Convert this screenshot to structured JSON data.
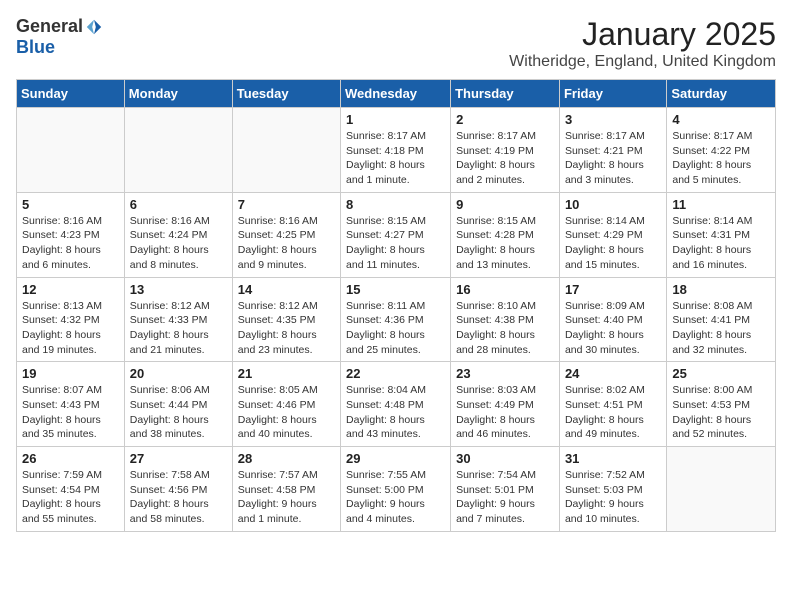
{
  "header": {
    "logo_general": "General",
    "logo_blue": "Blue",
    "month_title": "January 2025",
    "location": "Witheridge, England, United Kingdom"
  },
  "weekdays": [
    "Sunday",
    "Monday",
    "Tuesday",
    "Wednesday",
    "Thursday",
    "Friday",
    "Saturday"
  ],
  "weeks": [
    [
      {
        "day": "",
        "content": ""
      },
      {
        "day": "",
        "content": ""
      },
      {
        "day": "",
        "content": ""
      },
      {
        "day": "1",
        "content": "Sunrise: 8:17 AM\nSunset: 4:18 PM\nDaylight: 8 hours and 1 minute."
      },
      {
        "day": "2",
        "content": "Sunrise: 8:17 AM\nSunset: 4:19 PM\nDaylight: 8 hours and 2 minutes."
      },
      {
        "day": "3",
        "content": "Sunrise: 8:17 AM\nSunset: 4:21 PM\nDaylight: 8 hours and 3 minutes."
      },
      {
        "day": "4",
        "content": "Sunrise: 8:17 AM\nSunset: 4:22 PM\nDaylight: 8 hours and 5 minutes."
      }
    ],
    [
      {
        "day": "5",
        "content": "Sunrise: 8:16 AM\nSunset: 4:23 PM\nDaylight: 8 hours and 6 minutes."
      },
      {
        "day": "6",
        "content": "Sunrise: 8:16 AM\nSunset: 4:24 PM\nDaylight: 8 hours and 8 minutes."
      },
      {
        "day": "7",
        "content": "Sunrise: 8:16 AM\nSunset: 4:25 PM\nDaylight: 8 hours and 9 minutes."
      },
      {
        "day": "8",
        "content": "Sunrise: 8:15 AM\nSunset: 4:27 PM\nDaylight: 8 hours and 11 minutes."
      },
      {
        "day": "9",
        "content": "Sunrise: 8:15 AM\nSunset: 4:28 PM\nDaylight: 8 hours and 13 minutes."
      },
      {
        "day": "10",
        "content": "Sunrise: 8:14 AM\nSunset: 4:29 PM\nDaylight: 8 hours and 15 minutes."
      },
      {
        "day": "11",
        "content": "Sunrise: 8:14 AM\nSunset: 4:31 PM\nDaylight: 8 hours and 16 minutes."
      }
    ],
    [
      {
        "day": "12",
        "content": "Sunrise: 8:13 AM\nSunset: 4:32 PM\nDaylight: 8 hours and 19 minutes."
      },
      {
        "day": "13",
        "content": "Sunrise: 8:12 AM\nSunset: 4:33 PM\nDaylight: 8 hours and 21 minutes."
      },
      {
        "day": "14",
        "content": "Sunrise: 8:12 AM\nSunset: 4:35 PM\nDaylight: 8 hours and 23 minutes."
      },
      {
        "day": "15",
        "content": "Sunrise: 8:11 AM\nSunset: 4:36 PM\nDaylight: 8 hours and 25 minutes."
      },
      {
        "day": "16",
        "content": "Sunrise: 8:10 AM\nSunset: 4:38 PM\nDaylight: 8 hours and 28 minutes."
      },
      {
        "day": "17",
        "content": "Sunrise: 8:09 AM\nSunset: 4:40 PM\nDaylight: 8 hours and 30 minutes."
      },
      {
        "day": "18",
        "content": "Sunrise: 8:08 AM\nSunset: 4:41 PM\nDaylight: 8 hours and 32 minutes."
      }
    ],
    [
      {
        "day": "19",
        "content": "Sunrise: 8:07 AM\nSunset: 4:43 PM\nDaylight: 8 hours and 35 minutes."
      },
      {
        "day": "20",
        "content": "Sunrise: 8:06 AM\nSunset: 4:44 PM\nDaylight: 8 hours and 38 minutes."
      },
      {
        "day": "21",
        "content": "Sunrise: 8:05 AM\nSunset: 4:46 PM\nDaylight: 8 hours and 40 minutes."
      },
      {
        "day": "22",
        "content": "Sunrise: 8:04 AM\nSunset: 4:48 PM\nDaylight: 8 hours and 43 minutes."
      },
      {
        "day": "23",
        "content": "Sunrise: 8:03 AM\nSunset: 4:49 PM\nDaylight: 8 hours and 46 minutes."
      },
      {
        "day": "24",
        "content": "Sunrise: 8:02 AM\nSunset: 4:51 PM\nDaylight: 8 hours and 49 minutes."
      },
      {
        "day": "25",
        "content": "Sunrise: 8:00 AM\nSunset: 4:53 PM\nDaylight: 8 hours and 52 minutes."
      }
    ],
    [
      {
        "day": "26",
        "content": "Sunrise: 7:59 AM\nSunset: 4:54 PM\nDaylight: 8 hours and 55 minutes."
      },
      {
        "day": "27",
        "content": "Sunrise: 7:58 AM\nSunset: 4:56 PM\nDaylight: 8 hours and 58 minutes."
      },
      {
        "day": "28",
        "content": "Sunrise: 7:57 AM\nSunset: 4:58 PM\nDaylight: 9 hours and 1 minute."
      },
      {
        "day": "29",
        "content": "Sunrise: 7:55 AM\nSunset: 5:00 PM\nDaylight: 9 hours and 4 minutes."
      },
      {
        "day": "30",
        "content": "Sunrise: 7:54 AM\nSunset: 5:01 PM\nDaylight: 9 hours and 7 minutes."
      },
      {
        "day": "31",
        "content": "Sunrise: 7:52 AM\nSunset: 5:03 PM\nDaylight: 9 hours and 10 minutes."
      },
      {
        "day": "",
        "content": ""
      }
    ]
  ]
}
